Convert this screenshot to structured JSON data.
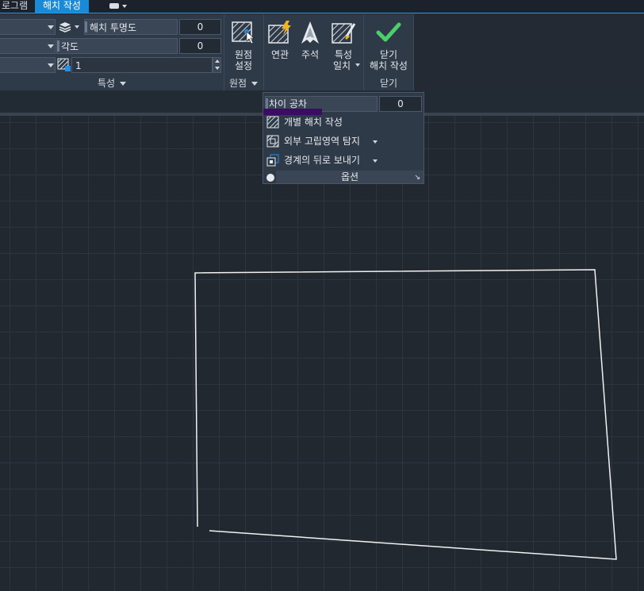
{
  "tabs": {
    "program": "로그램",
    "hatch_create": "해치 작성"
  },
  "properties": {
    "transparency_label": "해치 투명도",
    "transparency_value": "0",
    "angle_label": "각도",
    "angle_value": "0",
    "scale_value": "1",
    "panel_title": "특성"
  },
  "origin": {
    "set_origin_label_line1": "원점",
    "set_origin_label_line2": "설정",
    "panel_title": "원점"
  },
  "options": {
    "associative_label": "연관",
    "annotative_label": "주석",
    "match_props_line1": "특성",
    "match_props_line2": "일치",
    "gap_tolerance_label": "차이 공차",
    "gap_tolerance_value": "0",
    "separate_hatches_label": "개별 해치 작성",
    "island_detection_label": "외부 고립영역 탐지",
    "send_behind_label": "경계의 뒤로 보내기",
    "panel_title": "옵션"
  },
  "close": {
    "button_line1": "닫기",
    "button_line2": "해치 작성",
    "panel_title": "닫기"
  },
  "colors": {
    "accent": "#1a8ad6",
    "close_check": "#4ccf6a",
    "lightning": "#f2b31c",
    "selection_bar": "#3a0c63"
  }
}
